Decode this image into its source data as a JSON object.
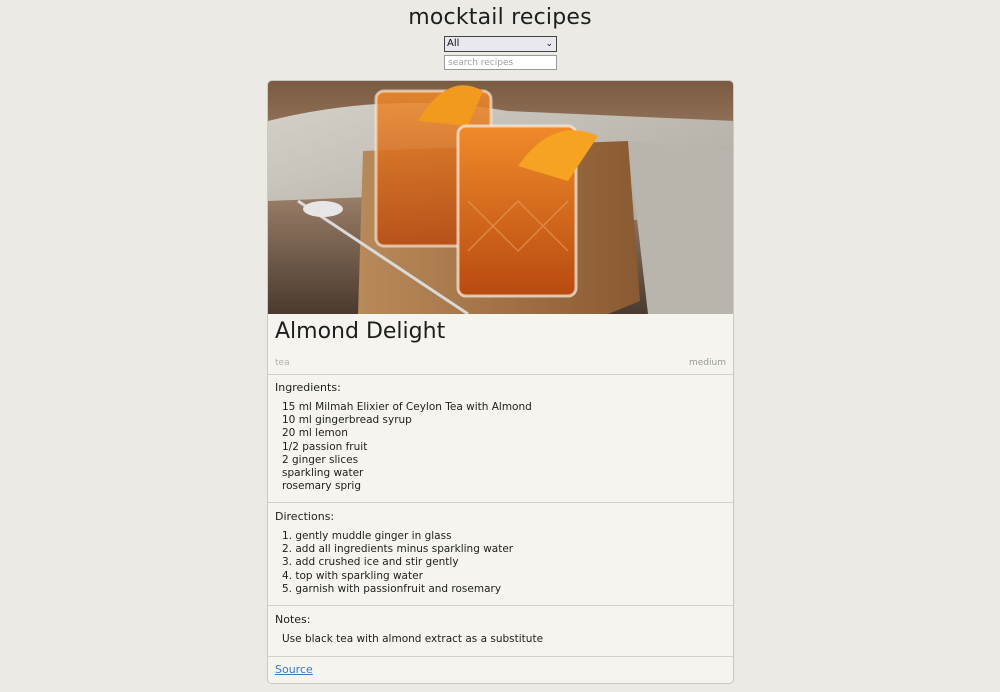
{
  "header": {
    "title": "mocktail recipes"
  },
  "filter": {
    "selected": "All"
  },
  "search": {
    "placeholder": "search recipes",
    "value": ""
  },
  "recipe": {
    "title": "Almond Delight",
    "base": "tea",
    "difficulty": "medium",
    "ingredients_label": "Ingredients:",
    "ingredients": [
      "15 ml Milmah Elixier of Ceylon Tea with Almond",
      "10 ml gingerbread syrup",
      "20 ml lemon",
      "1/2 passion fruit",
      "2 ginger slices",
      "sparkling water",
      "rosemary sprig"
    ],
    "directions_label": "Directions:",
    "directions": [
      "1. gently muddle ginger in glass",
      "2. add all ingredients minus sparkling water",
      "3. add crushed ice and stir gently",
      "4. top with sparkling water",
      "5. garnish with passionfruit and rosemary"
    ],
    "notes_label": "Notes:",
    "notes": "Use black tea with almond extract as a substitute",
    "source_label": "Source"
  },
  "colors": {
    "page_background": "#ebeae4",
    "card_background": "#f5f4ee",
    "link": "#3a7abf"
  }
}
